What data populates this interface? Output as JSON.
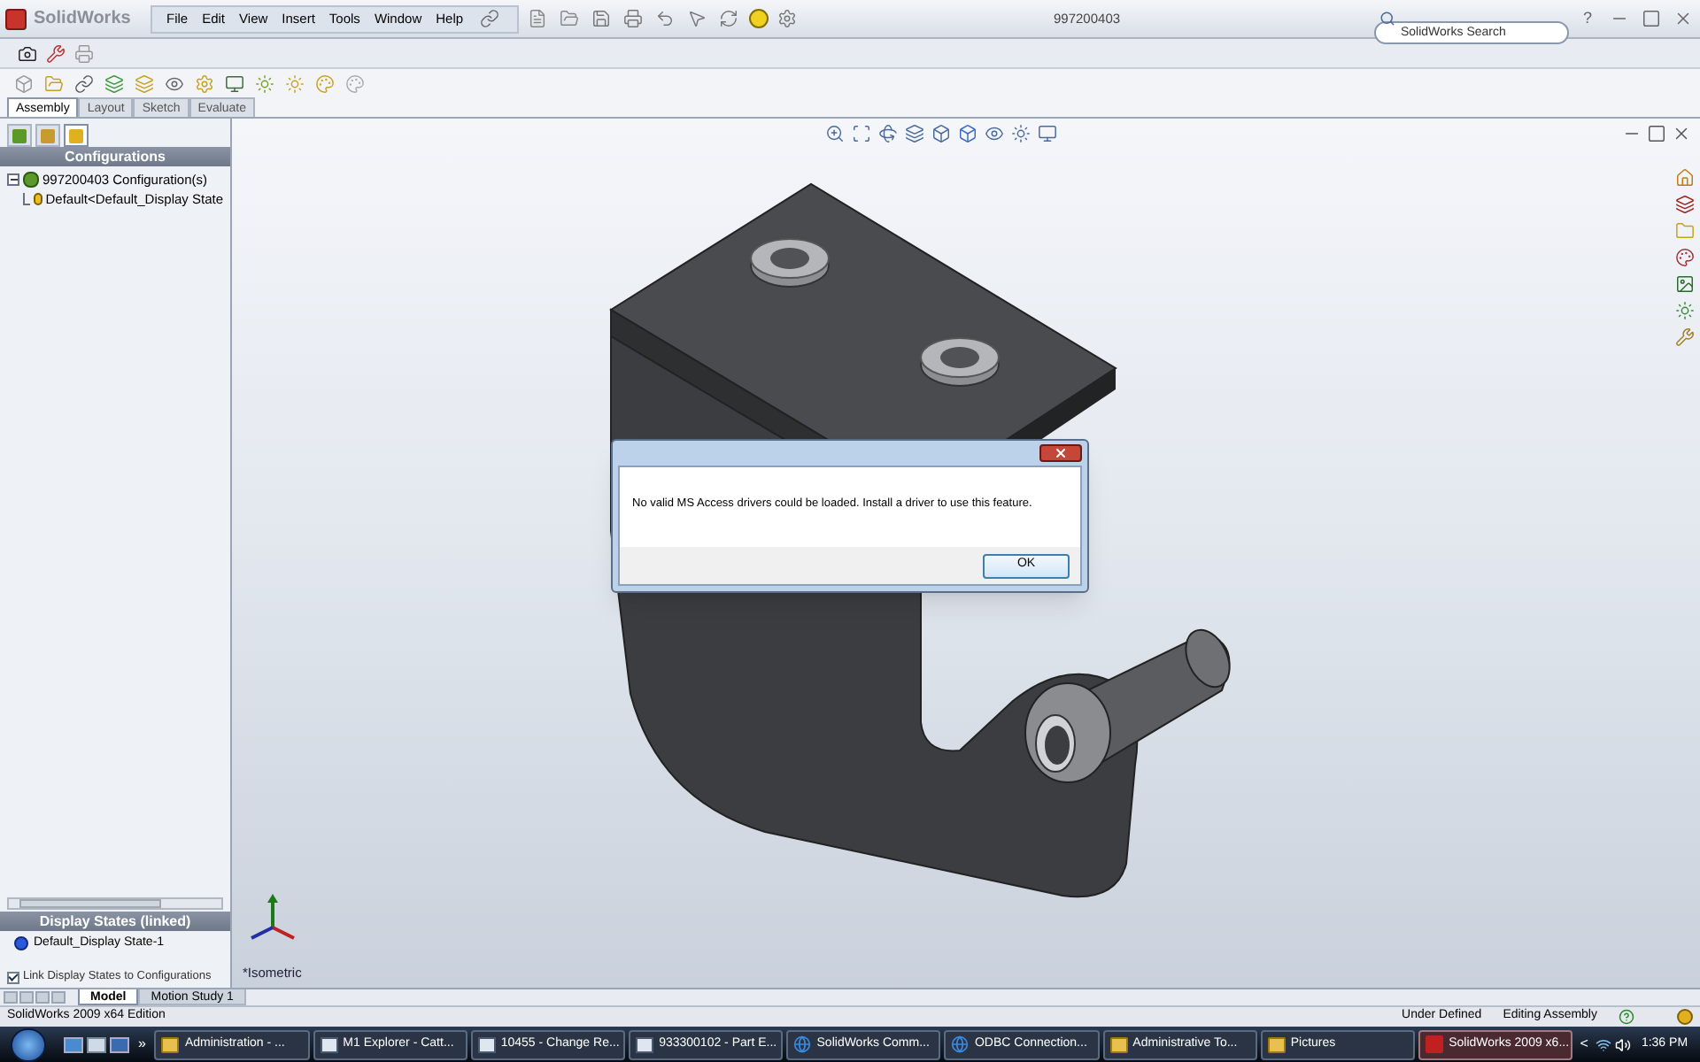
{
  "app": {
    "logo": "SolidWorks",
    "document_title": "997200403",
    "help": "?"
  },
  "menu": [
    "File",
    "Edit",
    "View",
    "Insert",
    "Tools",
    "Window",
    "Help"
  ],
  "search": {
    "placeholder": "SolidWorks Search"
  },
  "command_tabs": [
    {
      "label": "Assembly",
      "selected": true
    },
    {
      "label": "Layout",
      "selected": false
    },
    {
      "label": "Sketch",
      "selected": false
    },
    {
      "label": "Evaluate",
      "selected": false
    }
  ],
  "feature_manager": {
    "panel_tabs": [
      {
        "kind": "tree",
        "selected": false
      },
      {
        "kind": "property",
        "selected": false
      },
      {
        "kind": "configuration",
        "selected": true
      }
    ],
    "header": "Configurations",
    "tree": [
      {
        "label": "997200403 Configuration(s)",
        "expanded": true,
        "children": [
          {
            "label": "Default<Default_Display State"
          }
        ]
      }
    ]
  },
  "display_states": {
    "header": "Display States (linked)",
    "items": [
      "Default_Display State-1"
    ],
    "link_option": {
      "label": "Link Display States to Configurations",
      "checked": true
    }
  },
  "viewport": {
    "view_label": "*Isometric"
  },
  "dialog": {
    "message": "No valid MS Access drivers could be loaded. Install a driver to use this feature.",
    "button": "OK"
  },
  "bottom_tabs": [
    {
      "label": "Model",
      "selected": true
    },
    {
      "label": "Motion Study 1",
      "selected": false
    }
  ],
  "status_bar": {
    "product": "SolidWorks 2009 x64 Edition",
    "state": "Under Defined",
    "mode": "Editing Assembly"
  },
  "taskbar": {
    "overflow": "»",
    "tasks": [
      {
        "label": "Administration - ...",
        "kind": "folder",
        "selected": false
      },
      {
        "label": "M1 Explorer - Catt...",
        "kind": "app",
        "selected": false
      },
      {
        "label": "10455 - Change Re...",
        "kind": "app",
        "selected": false
      },
      {
        "label": "933300102 - Part E...",
        "kind": "app",
        "selected": false
      },
      {
        "label": "SolidWorks Comm...",
        "kind": "browser",
        "selected": false
      },
      {
        "label": "ODBC Connection...",
        "kind": "browser",
        "selected": false
      },
      {
        "label": "Administrative To...",
        "kind": "folder",
        "selected": false
      },
      {
        "label": "Pictures",
        "kind": "folder",
        "selected": false
      },
      {
        "label": "SolidWorks 2009 x6...",
        "kind": "solidworks",
        "selected": true
      }
    ],
    "tray_expander": "<",
    "clock": "1:36 PM"
  }
}
